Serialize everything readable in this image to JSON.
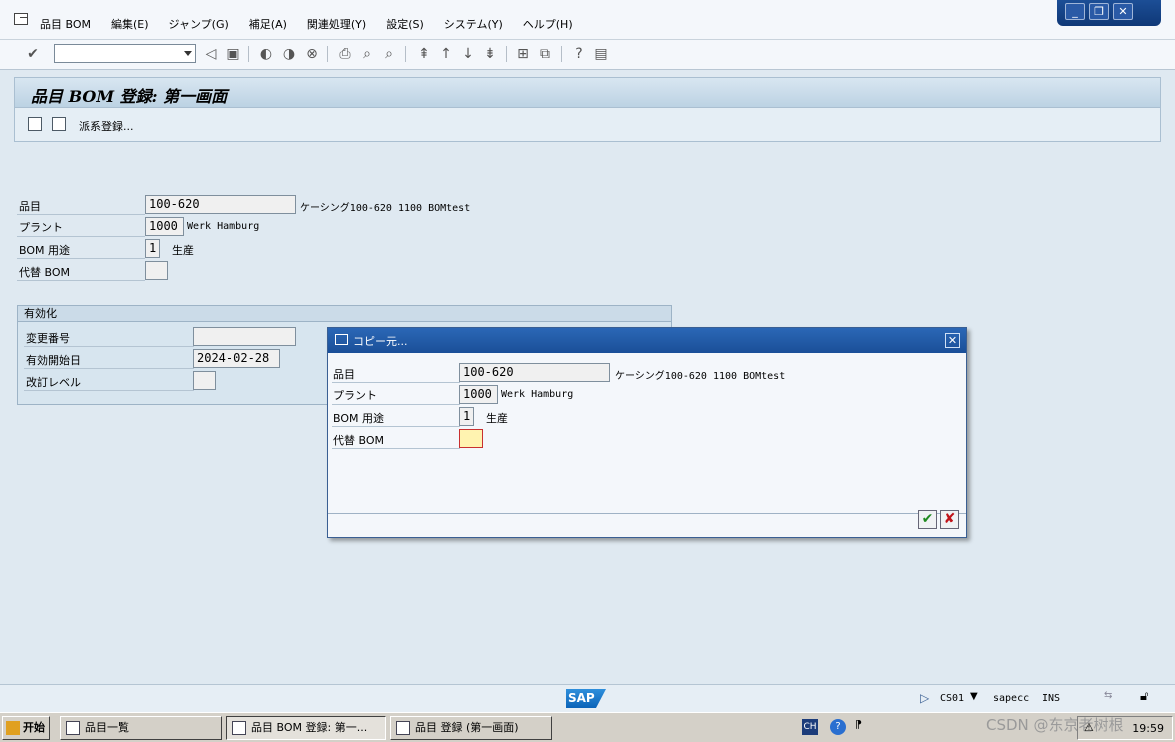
{
  "menubar": {
    "items": [
      "品目 BOM",
      "編集(E)",
      "ジャンプ(G)",
      "補足(A)",
      "関連処理(Y)",
      "設定(S)",
      "システム(Y)",
      "ヘルプ(H)"
    ]
  },
  "screen": {
    "title": "品目 BOM 登録: 第一画面",
    "app_toolbar_label": "派系登録..."
  },
  "form": {
    "material_label": "品目",
    "material_value": "100-620",
    "material_desc": "ケーシング100-620 1100 BOMtest",
    "plant_label": "プラント",
    "plant_value": "1000",
    "plant_desc": "Werk Hamburg",
    "usage_label": "BOM 用途",
    "usage_value": "1",
    "usage_desc": "生産",
    "alt_label": "代替 BOM",
    "alt_value": ""
  },
  "validity": {
    "title": "有効化",
    "change_no_label": "変更番号",
    "change_no_value": "",
    "valid_from_label": "有効開始日",
    "valid_from_value": "2024-02-28",
    "revision_label": "改訂レベル",
    "revision_value": ""
  },
  "popup": {
    "title": "コピー元...",
    "material_label": "品目",
    "material_value": "100-620",
    "material_desc": "ケーシング100-620 1100 BOMtest",
    "plant_label": "プラント",
    "plant_value": "1000",
    "plant_desc": "Werk Hamburg",
    "usage_label": "BOM 用途",
    "usage_value": "1",
    "usage_desc": "生産",
    "alt_label": "代替 BOM",
    "alt_value": ""
  },
  "statusbar": {
    "transaction": "CS01",
    "system": "sapecc",
    "mode": "INS"
  },
  "taskbar": {
    "start": "开始",
    "tasks": [
      "品目一覧",
      "品目 BOM 登録: 第一...",
      "品目 登録 (第一画面)"
    ],
    "tray_lang": "CH",
    "clock": "19:59",
    "watermark": "CSDN @东京老树根"
  },
  "colors": {
    "accent": "#1a4f98",
    "work_bg": "#dfe9f1",
    "focus_field": "#fff3b0"
  }
}
